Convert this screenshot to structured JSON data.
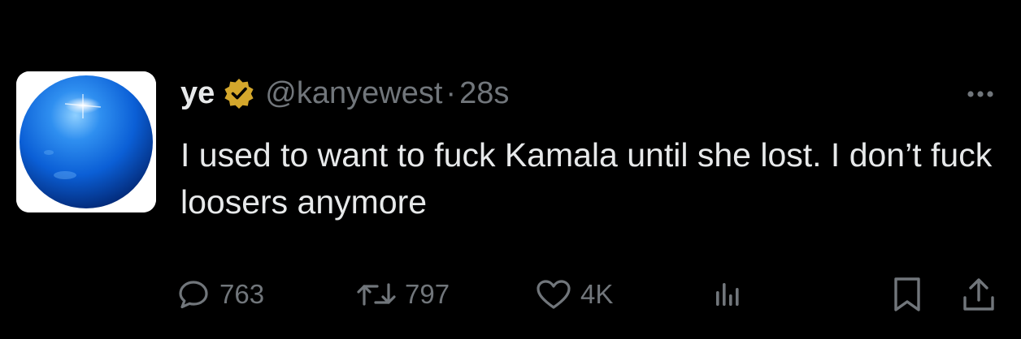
{
  "tweet": {
    "display_name": "ye",
    "handle": "@kanyewest",
    "separator": "·",
    "time": "28s",
    "text": "I used to want to fuck Kamala until she lost. I don’t fuck loosers anymore",
    "verified_color": "#d4a72c",
    "avatar_icon": "blue-orb-avatar",
    "more_icon": "ellipsis-icon"
  },
  "actions": {
    "reply": {
      "icon": "reply-bubble-icon",
      "count": "763"
    },
    "retweet": {
      "icon": "retweet-icon",
      "count": "797"
    },
    "like": {
      "icon": "heart-icon",
      "count": "4K"
    },
    "views": {
      "icon": "analytics-bars-icon"
    },
    "bookmark": {
      "icon": "bookmark-icon"
    },
    "share": {
      "icon": "share-upload-icon"
    }
  },
  "colors": {
    "background": "#000000",
    "primary_text": "#e7e9ea",
    "secondary_text": "#71767b"
  }
}
